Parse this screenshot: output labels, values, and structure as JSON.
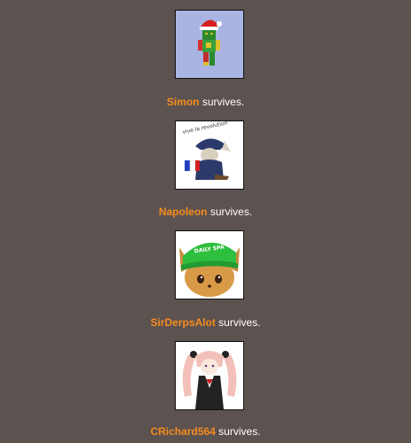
{
  "entries": [
    {
      "name": "Simon",
      "status": " survives.",
      "avatar": "minecraft-santa-avatar-icon"
    },
    {
      "name": "Napoleon",
      "status": " survives.",
      "avatar": "napoleon-character-avatar-icon",
      "avatar_text": "vive la revolution"
    },
    {
      "name": "SirDerpsAlot",
      "status": " survives.",
      "avatar": "eevee-green-cap-avatar-icon",
      "avatar_text": "DAILY SPA"
    },
    {
      "name": "CRichard564",
      "status": " survives.",
      "avatar": "anime-pigtails-girl-avatar-icon"
    }
  ],
  "colors": {
    "background": "#5c5250",
    "name": "#f58c1e",
    "text": "#ffffff"
  }
}
